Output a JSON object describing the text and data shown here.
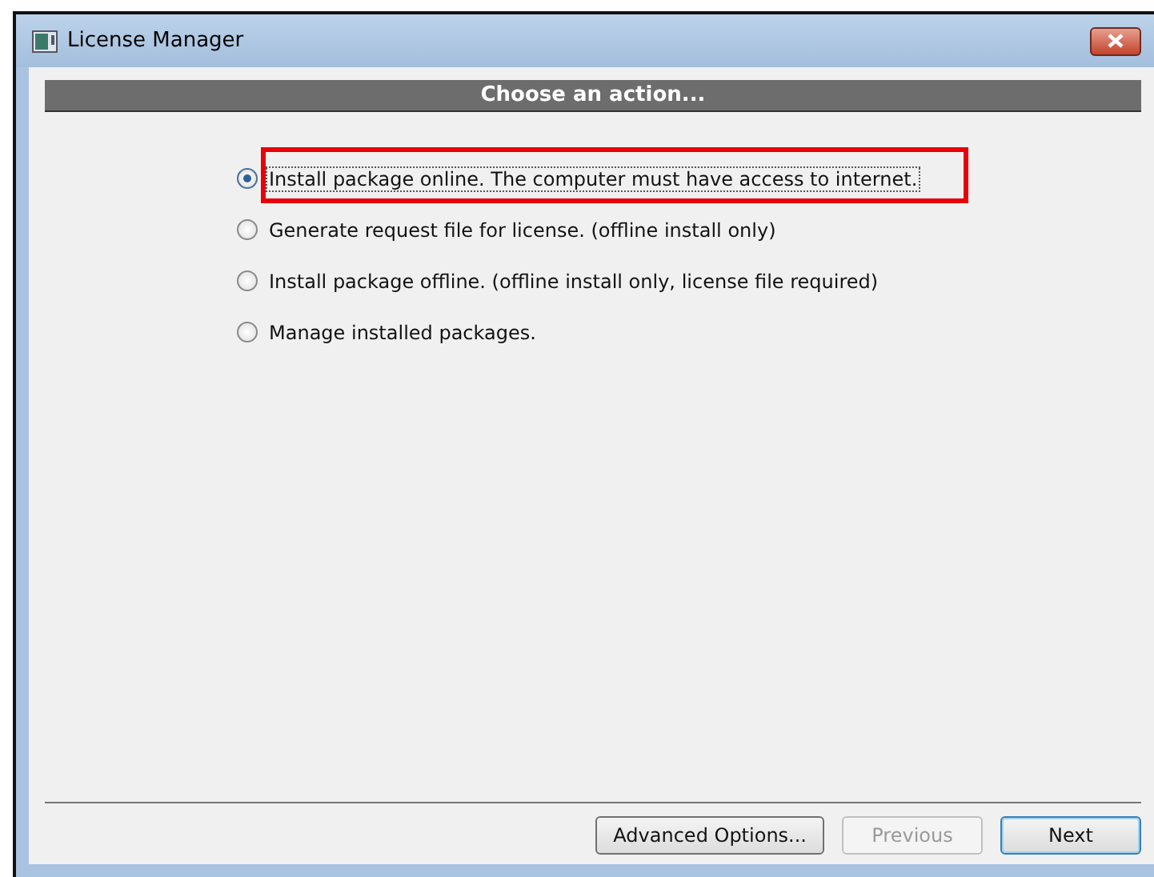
{
  "window": {
    "title": "License Manager"
  },
  "header": "Choose an action...",
  "options": [
    {
      "label": "Install package online. The computer must have access to internet.",
      "selected": true,
      "focused": true
    },
    {
      "label": "Generate request file for license. (offline install only)",
      "selected": false,
      "focused": false
    },
    {
      "label": "Install package offline. (offline install only, license file required)",
      "selected": false,
      "focused": false
    },
    {
      "label": "Manage installed packages.",
      "selected": false,
      "focused": false
    }
  ],
  "buttons": [
    {
      "label": "Advanced Options...",
      "disabled": false,
      "default": false
    },
    {
      "label": "Previous",
      "disabled": true,
      "default": false
    },
    {
      "label": "Next",
      "disabled": false,
      "default": true
    }
  ]
}
